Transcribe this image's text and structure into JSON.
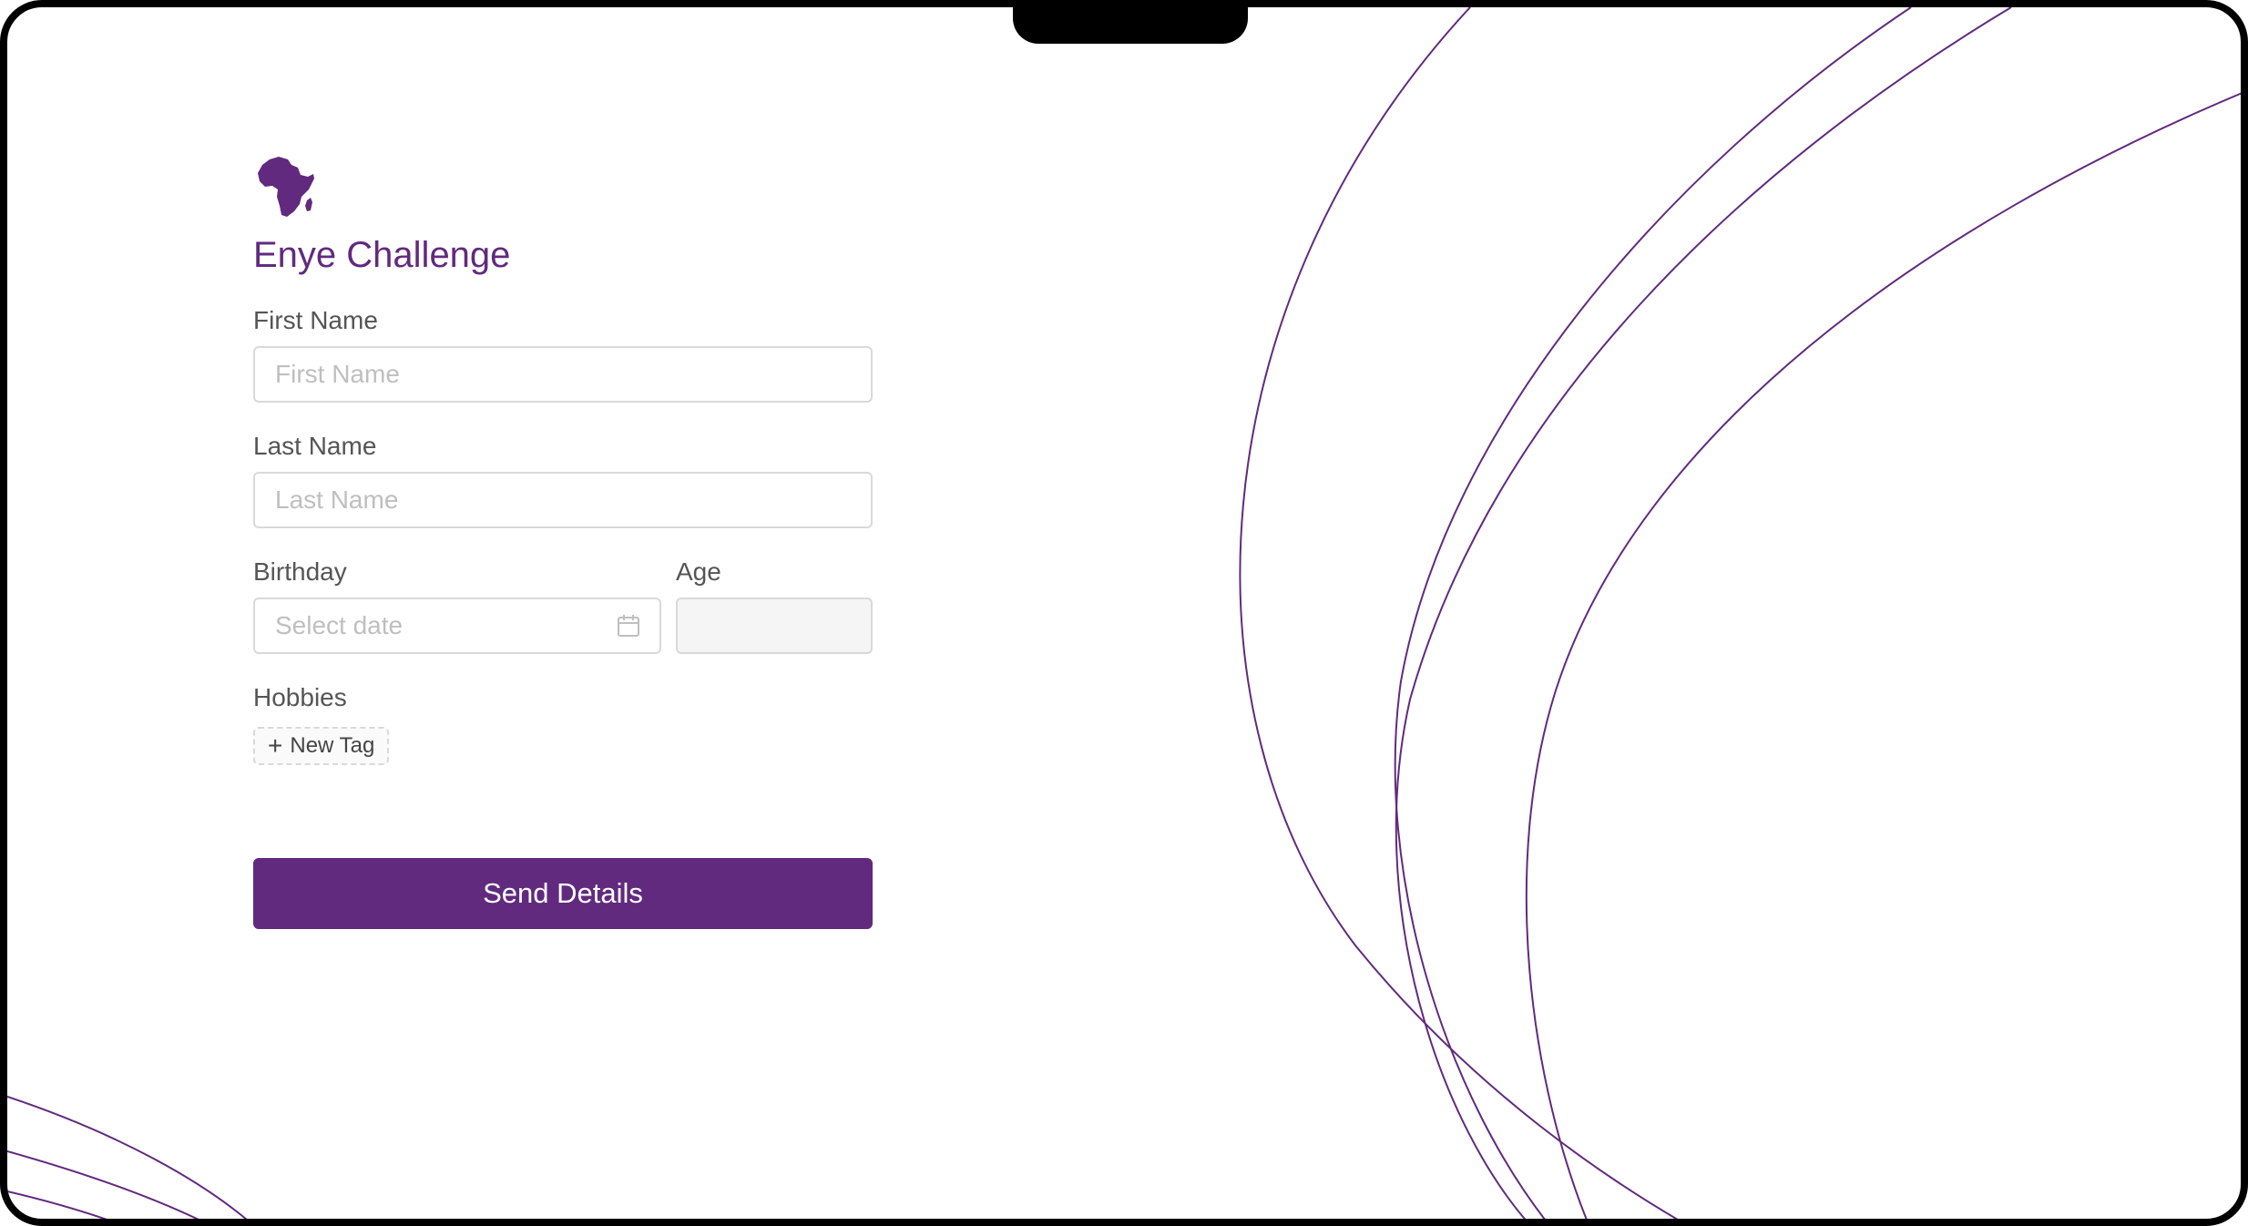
{
  "app": {
    "title": "Enye Challenge",
    "logo_icon": "africa-map-icon",
    "accent_color": "#612a7e"
  },
  "form": {
    "first_name": {
      "label": "First Name",
      "placeholder": "First Name",
      "value": ""
    },
    "last_name": {
      "label": "Last Name",
      "placeholder": "Last Name",
      "value": ""
    },
    "birthday": {
      "label": "Birthday",
      "placeholder": "Select date",
      "value": "",
      "icon": "calendar-icon"
    },
    "age": {
      "label": "Age",
      "value": ""
    },
    "hobbies": {
      "label": "Hobbies",
      "add_tag_label": "New Tag",
      "add_tag_icon": "plus-icon",
      "tags": []
    },
    "submit_label": "Send Details"
  }
}
